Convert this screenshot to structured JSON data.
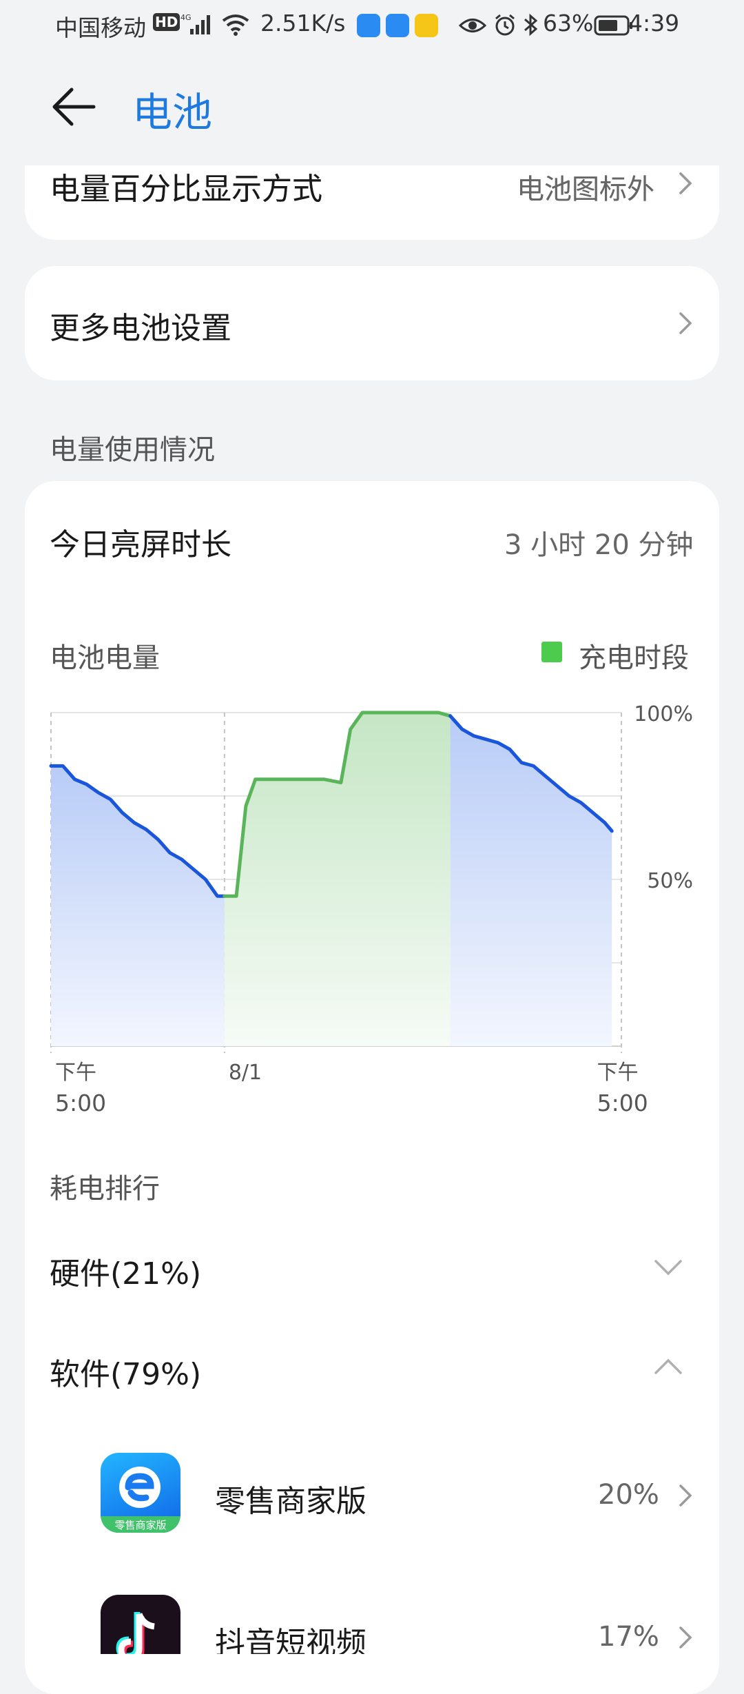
{
  "status_bar": {
    "carrier": "中国移动",
    "hd_badge": "HD",
    "network_speed": "2.51K/s",
    "battery_percent": "63%",
    "time": "4:39",
    "app_icons": [
      "retail-app-icon",
      "retail-app-icon",
      "delivery-app-icon"
    ],
    "icons": [
      "signal-icon",
      "wifi-icon",
      "eye-icon",
      "alarm-icon",
      "bluetooth-icon",
      "battery-icon"
    ]
  },
  "header": {
    "title": "电池",
    "back_icon": "arrow-left-icon"
  },
  "settings": {
    "percentage_display": {
      "label": "电量百分比显示方式",
      "value": "电池图标外"
    },
    "more_battery": {
      "label": "更多电池设置"
    }
  },
  "usage": {
    "section_title": "电量使用情况",
    "screen_time_label": "今日亮屏时长",
    "screen_time_value": "3 小时 20 分钟",
    "chart_title": "电池电量",
    "legend_label": "充电时段"
  },
  "chart_data": {
    "type": "area",
    "title": "电池电量",
    "y_ticks": [
      "100%",
      "50%"
    ],
    "ylim": [
      0,
      100
    ],
    "x_ticks": [
      {
        "line1": "下午",
        "line2": "5:00"
      },
      {
        "line1": "8/1",
        "line2": ""
      },
      {
        "line1": "下午",
        "line2": "5:00"
      }
    ],
    "xlim": [
      0,
      24
    ],
    "series": [
      {
        "name": "",
        "values": [
          [
            0,
            84
          ],
          [
            0.5,
            84
          ],
          [
            1,
            80
          ],
          [
            1.5,
            78.5
          ],
          [
            2,
            76
          ],
          [
            2.5,
            74
          ],
          [
            3,
            70
          ],
          [
            3.5,
            67
          ],
          [
            4,
            65
          ],
          [
            4.5,
            62
          ],
          [
            5,
            58
          ],
          [
            5.5,
            56
          ],
          [
            6,
            53
          ],
          [
            6.5,
            50
          ],
          [
            7,
            45
          ],
          [
            7.3,
            45
          ]
        ]
      },
      {
        "name": "充电时段",
        "values": [
          [
            7.3,
            45
          ],
          [
            7.8,
            45
          ],
          [
            8.2,
            72
          ],
          [
            8.6,
            80
          ],
          [
            9.5,
            80
          ],
          [
            10.5,
            80
          ],
          [
            11.5,
            80
          ],
          [
            12.2,
            79
          ],
          [
            12.6,
            95
          ],
          [
            13.1,
            100
          ],
          [
            14,
            100
          ],
          [
            15,
            100
          ],
          [
            16.3,
            100
          ],
          [
            16.8,
            99
          ]
        ]
      },
      {
        "name": "",
        "values": [
          [
            16.8,
            99
          ],
          [
            17.3,
            95
          ],
          [
            17.8,
            93
          ],
          [
            18.3,
            92
          ],
          [
            18.8,
            91
          ],
          [
            19.3,
            89
          ],
          [
            19.8,
            85
          ],
          [
            20.3,
            84
          ],
          [
            20.8,
            81
          ],
          [
            21.3,
            78
          ],
          [
            21.8,
            75
          ],
          [
            22.3,
            73
          ],
          [
            22.8,
            70
          ],
          [
            23.3,
            67
          ],
          [
            23.6,
            64.5
          ]
        ]
      }
    ],
    "colors": {
      "discharge_line": "#1a56db",
      "discharge_fill": "#b7cdf7",
      "charge_line": "#5ab55a",
      "charge_fill": "#c6e8c6",
      "grid": "#e5e5e5"
    }
  },
  "ranking": {
    "title": "耗电排行",
    "hardware": "硬件(21%)",
    "software": "软件(79%)",
    "apps": [
      {
        "name": "零售商家版",
        "percent": "20%",
        "icon": "retail-merchant-app-icon",
        "icon_caption": "零售商家版"
      },
      {
        "name": "抖音短视频",
        "percent": "17%",
        "icon": "douyin-app-icon"
      }
    ]
  }
}
